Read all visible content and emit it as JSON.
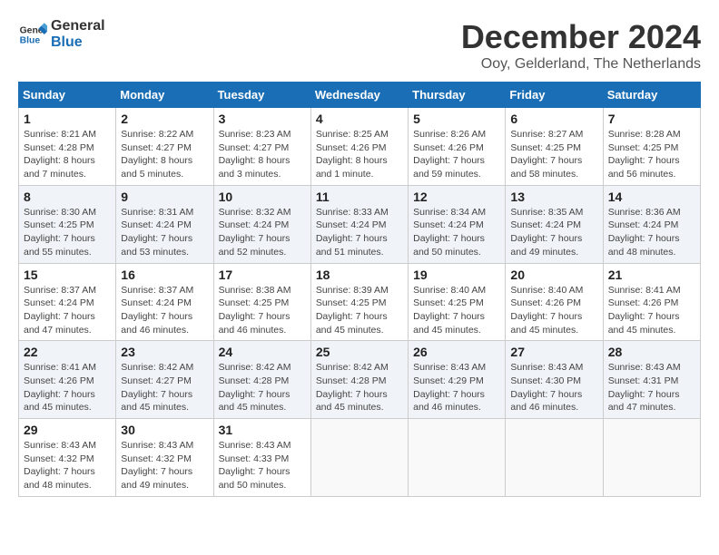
{
  "header": {
    "logo_line1": "General",
    "logo_line2": "Blue",
    "month_title": "December 2024",
    "location": "Ooy, Gelderland, The Netherlands"
  },
  "weekdays": [
    "Sunday",
    "Monday",
    "Tuesday",
    "Wednesday",
    "Thursday",
    "Friday",
    "Saturday"
  ],
  "weeks": [
    [
      {
        "day": "1",
        "sunrise": "8:21 AM",
        "sunset": "4:28 PM",
        "daylight": "8 hours and 7 minutes."
      },
      {
        "day": "2",
        "sunrise": "8:22 AM",
        "sunset": "4:27 PM",
        "daylight": "8 hours and 5 minutes."
      },
      {
        "day": "3",
        "sunrise": "8:23 AM",
        "sunset": "4:27 PM",
        "daylight": "8 hours and 3 minutes."
      },
      {
        "day": "4",
        "sunrise": "8:25 AM",
        "sunset": "4:26 PM",
        "daylight": "8 hours and 1 minute."
      },
      {
        "day": "5",
        "sunrise": "8:26 AM",
        "sunset": "4:26 PM",
        "daylight": "7 hours and 59 minutes."
      },
      {
        "day": "6",
        "sunrise": "8:27 AM",
        "sunset": "4:25 PM",
        "daylight": "7 hours and 58 minutes."
      },
      {
        "day": "7",
        "sunrise": "8:28 AM",
        "sunset": "4:25 PM",
        "daylight": "7 hours and 56 minutes."
      }
    ],
    [
      {
        "day": "8",
        "sunrise": "8:30 AM",
        "sunset": "4:25 PM",
        "daylight": "7 hours and 55 minutes."
      },
      {
        "day": "9",
        "sunrise": "8:31 AM",
        "sunset": "4:24 PM",
        "daylight": "7 hours and 53 minutes."
      },
      {
        "day": "10",
        "sunrise": "8:32 AM",
        "sunset": "4:24 PM",
        "daylight": "7 hours and 52 minutes."
      },
      {
        "day": "11",
        "sunrise": "8:33 AM",
        "sunset": "4:24 PM",
        "daylight": "7 hours and 51 minutes."
      },
      {
        "day": "12",
        "sunrise": "8:34 AM",
        "sunset": "4:24 PM",
        "daylight": "7 hours and 50 minutes."
      },
      {
        "day": "13",
        "sunrise": "8:35 AM",
        "sunset": "4:24 PM",
        "daylight": "7 hours and 49 minutes."
      },
      {
        "day": "14",
        "sunrise": "8:36 AM",
        "sunset": "4:24 PM",
        "daylight": "7 hours and 48 minutes."
      }
    ],
    [
      {
        "day": "15",
        "sunrise": "8:37 AM",
        "sunset": "4:24 PM",
        "daylight": "7 hours and 47 minutes."
      },
      {
        "day": "16",
        "sunrise": "8:37 AM",
        "sunset": "4:24 PM",
        "daylight": "7 hours and 46 minutes."
      },
      {
        "day": "17",
        "sunrise": "8:38 AM",
        "sunset": "4:25 PM",
        "daylight": "7 hours and 46 minutes."
      },
      {
        "day": "18",
        "sunrise": "8:39 AM",
        "sunset": "4:25 PM",
        "daylight": "7 hours and 45 minutes."
      },
      {
        "day": "19",
        "sunrise": "8:40 AM",
        "sunset": "4:25 PM",
        "daylight": "7 hours and 45 minutes."
      },
      {
        "day": "20",
        "sunrise": "8:40 AM",
        "sunset": "4:26 PM",
        "daylight": "7 hours and 45 minutes."
      },
      {
        "day": "21",
        "sunrise": "8:41 AM",
        "sunset": "4:26 PM",
        "daylight": "7 hours and 45 minutes."
      }
    ],
    [
      {
        "day": "22",
        "sunrise": "8:41 AM",
        "sunset": "4:26 PM",
        "daylight": "7 hours and 45 minutes."
      },
      {
        "day": "23",
        "sunrise": "8:42 AM",
        "sunset": "4:27 PM",
        "daylight": "7 hours and 45 minutes."
      },
      {
        "day": "24",
        "sunrise": "8:42 AM",
        "sunset": "4:28 PM",
        "daylight": "7 hours and 45 minutes."
      },
      {
        "day": "25",
        "sunrise": "8:42 AM",
        "sunset": "4:28 PM",
        "daylight": "7 hours and 45 minutes."
      },
      {
        "day": "26",
        "sunrise": "8:43 AM",
        "sunset": "4:29 PM",
        "daylight": "7 hours and 46 minutes."
      },
      {
        "day": "27",
        "sunrise": "8:43 AM",
        "sunset": "4:30 PM",
        "daylight": "7 hours and 46 minutes."
      },
      {
        "day": "28",
        "sunrise": "8:43 AM",
        "sunset": "4:31 PM",
        "daylight": "7 hours and 47 minutes."
      }
    ],
    [
      {
        "day": "29",
        "sunrise": "8:43 AM",
        "sunset": "4:32 PM",
        "daylight": "7 hours and 48 minutes."
      },
      {
        "day": "30",
        "sunrise": "8:43 AM",
        "sunset": "4:32 PM",
        "daylight": "7 hours and 49 minutes."
      },
      {
        "day": "31",
        "sunrise": "8:43 AM",
        "sunset": "4:33 PM",
        "daylight": "7 hours and 50 minutes."
      },
      null,
      null,
      null,
      null
    ]
  ],
  "labels": {
    "sunrise": "Sunrise:",
    "sunset": "Sunset:",
    "daylight": "Daylight:"
  }
}
